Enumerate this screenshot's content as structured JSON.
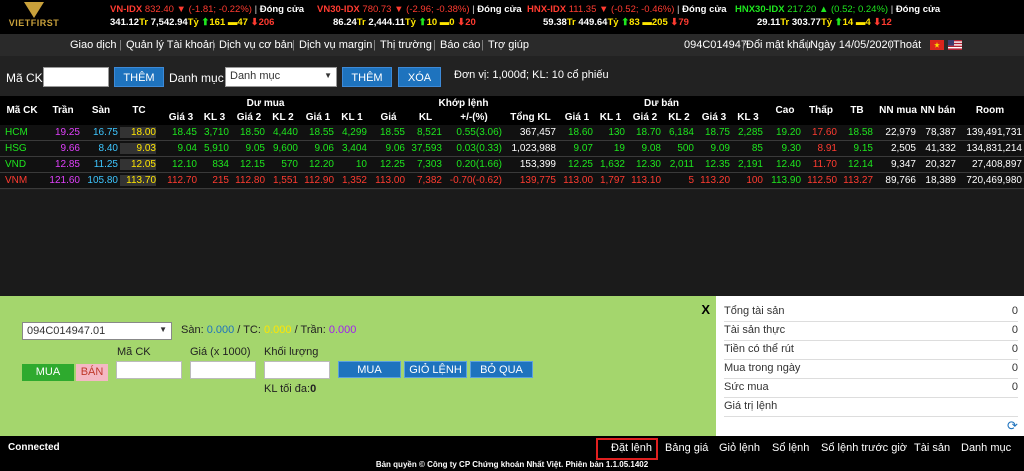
{
  "brand": "VIETFIRST",
  "indices": [
    {
      "name": "VN-IDX",
      "value": "832.40",
      "change": "(-1.81; -0.22%)",
      "status": "Đóng cửa",
      "vol": "341.12",
      "volunit": "Tr",
      "val": "7,542.94",
      "valunit": "Tỷ",
      "up": "161",
      "ref": "47",
      "down": "206"
    },
    {
      "name": "VN30-IDX",
      "value": "780.73",
      "change": "(-2.96; -0.38%)",
      "status": "Đóng cửa",
      "vol": "86.24",
      "volunit": "Tr",
      "val": "2,444.11",
      "valunit": "Tỷ",
      "up": "10",
      "ref": "0",
      "down": "20"
    },
    {
      "name": "HNX-IDX",
      "value": "111.35",
      "change": "(-0.52; -0.46%)",
      "status": "Đóng cửa",
      "vol": "59.38",
      "volunit": "Tr",
      "val": "449.64",
      "valunit": "Tỷ",
      "up": "83",
      "ref": "205",
      "down": "79"
    },
    {
      "name": "HNX30-IDX",
      "value": "217.20",
      "change": "(0.52; 0.24%)",
      "status": "Đóng cửa",
      "vol": "29.11",
      "volunit": "Tr",
      "val": "303.77",
      "valunit": "Tỷ",
      "up": "14",
      "ref": "4",
      "down": "12"
    }
  ],
  "menu": [
    "Giao dịch",
    "Quản lý Tài khoản",
    "Dịch vụ cơ bản",
    "Dịch vụ margin",
    "Thị trường",
    "Báo cáo",
    "Trợ giúp"
  ],
  "account_menu": {
    "account": "094C014947",
    "change_pw": "Đổi mật khẩu",
    "date": "Ngày 14/05/2020",
    "logout": "Thoát"
  },
  "toolbar": {
    "ma_ck_label": "Mã CK",
    "them1": "THÊM",
    "danh_muc_label": "Danh mục",
    "danh_muc_value": "Danh mục",
    "them2": "THÊM",
    "xoa": "XÓA",
    "unit": "Đơn vị: 1,000đ; KL: 10 cổ phiếu"
  },
  "table_head": {
    "ma_ck": "Mã CK",
    "tran": "Trần",
    "san": "Sàn",
    "tc": "TC",
    "du_mua": "Dư mua",
    "khop_lenh": "Khớp lệnh",
    "du_ban": "Dư bán",
    "gia3": "Giá 3",
    "kl3": "KL 3",
    "gia2": "Giá 2",
    "kl2": "KL 2",
    "gia1": "Giá 1",
    "kl1": "KL 1",
    "gia": "Giá",
    "kl": "KL",
    "pct": "+/-(%)",
    "tong_kl": "Tổng KL",
    "cao": "Cao",
    "thap": "Thấp",
    "tb": "TB",
    "nn_mua": "NN mua",
    "nn_ban": "NN bán",
    "room": "Room"
  },
  "rows": [
    {
      "code": "HCM",
      "c": [
        "19.25",
        "16.75",
        "18.00",
        "18.45",
        "3,710",
        "18.50",
        "4,440",
        "18.55",
        "4,299",
        "18.55",
        "8,521",
        "0.55(3.06)",
        "367,457",
        "18.60",
        "130",
        "18.70",
        "6,184",
        "18.75",
        "2,285",
        "19.20",
        "17.60",
        "18.58",
        "22,979",
        "78,387",
        "139,491,731"
      ]
    },
    {
      "code": "HSG",
      "c": [
        "9.66",
        "8.40",
        "9.03",
        "9.04",
        "5,910",
        "9.05",
        "9,600",
        "9.06",
        "3,404",
        "9.06",
        "37,593",
        "0.03(0.33)",
        "1,023,988",
        "9.07",
        "19",
        "9.08",
        "500",
        "9.09",
        "85",
        "9.30",
        "8.91",
        "9.15",
        "2,505",
        "41,332",
        "134,831,214"
      ]
    },
    {
      "code": "VND",
      "c": [
        "12.85",
        "11.25",
        "12.05",
        "12.10",
        "834",
        "12.15",
        "570",
        "12.20",
        "10",
        "12.25",
        "7,303",
        "0.20(1.66)",
        "153,399",
        "12.25",
        "1,632",
        "12.30",
        "2,011",
        "12.35",
        "2,191",
        "12.40",
        "11.70",
        "12.14",
        "9,347",
        "20,327",
        "27,408,897"
      ]
    },
    {
      "code": "VNM",
      "c": [
        "121.60",
        "105.80",
        "113.70",
        "112.70",
        "215",
        "112.80",
        "1,551",
        "112.90",
        "1,352",
        "113.00",
        "7,382",
        "-0.70(-0.62)",
        "139,775",
        "113.00",
        "1,797",
        "113.10",
        "5",
        "113.20",
        "100",
        "113.90",
        "112.50",
        "113.27",
        "89,766",
        "18,389",
        "720,469,980"
      ]
    }
  ],
  "order": {
    "close": "X",
    "account": "094C014947.01",
    "san_label": "Sàn:",
    "san_value": "0.000",
    "tc_label": "/ TC:",
    "tc_value": "0.000",
    "tran_label": "/ Trần:",
    "tran_value": "0.000",
    "ma_ck": "Mã CK",
    "gia": "Giá (x 1000)",
    "khoi_luong": "Khối lượng",
    "mua_tab": "MUA",
    "ban_tab": "BÁN",
    "mua_btn": "MUA",
    "gio_lenh_btn": "GIỎ LỆNH",
    "bo_qua_btn": "BỎ QUA",
    "kl_toi_da_label": "KL tối đa:",
    "kl_toi_da_value": "0"
  },
  "account_summary": [
    {
      "k": "Tổng tài sản",
      "v": "0"
    },
    {
      "k": "Tài sản thực",
      "v": "0"
    },
    {
      "k": "Tiền có thể rút",
      "v": "0"
    },
    {
      "k": "Mua trong ngày",
      "v": "0"
    },
    {
      "k": "Sức mua",
      "v": "0"
    },
    {
      "k": "Giá trị lệnh",
      "v": ""
    }
  ],
  "bottom": {
    "status": "Connected",
    "nav": [
      "Đặt lệnh",
      "Bảng giá",
      "Giỏ lệnh",
      "Sổ lệnh",
      "Sổ lệnh trước giờ",
      "Tài sản",
      "Danh mục"
    ],
    "copyright": "Bản quyền © Công ty CP Chứng khoán Nhất Việt. Phiên bản 1.1.05.1402"
  }
}
